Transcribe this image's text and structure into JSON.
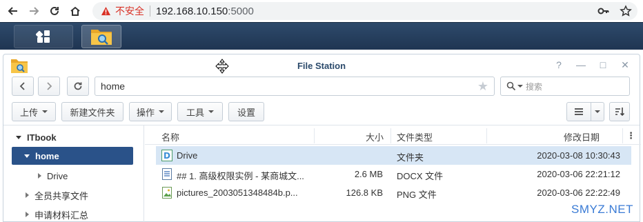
{
  "browser": {
    "warning": "不安全",
    "url_host": "192.168.10.150",
    "url_port": ":5000"
  },
  "window": {
    "title": "File Station",
    "help": "?",
    "minimize": "—",
    "maximize": "□",
    "close": "✕"
  },
  "toolbar": {
    "path": "home",
    "search_placeholder": "搜索",
    "upload": "上传",
    "new_folder": "新建文件夹",
    "action": "操作",
    "tools": "工具",
    "settings": "设置"
  },
  "tree": {
    "root": "ITbook",
    "selected": "home",
    "drive": "Drive",
    "shared": "全员共享文件",
    "apply": "申请材料汇总"
  },
  "list": {
    "headers": {
      "name": "名称",
      "size": "大小",
      "type": "文件类型",
      "modified": "修改日期"
    },
    "rows": [
      {
        "name": "Drive",
        "size": "",
        "type": "文件夹",
        "modified": "2020-03-08 10:30:43"
      },
      {
        "name": "## 1. 高级权限实例 - 某商城文...",
        "size": "2.6 MB",
        "type": "DOCX 文件",
        "modified": "2020-03-06 22:21:12"
      },
      {
        "name": "pictures_2003051348484b.p...",
        "size": "126.8 KB",
        "type": "PNG 文件",
        "modified": "2020-03-06 22:22:49"
      }
    ]
  },
  "watermark": "SMYZ.NET",
  "colors": {
    "selection": "#2a5289",
    "row_selected": "#d7e6f5",
    "taskbar": "#1f3552",
    "warning": "#d93025"
  }
}
